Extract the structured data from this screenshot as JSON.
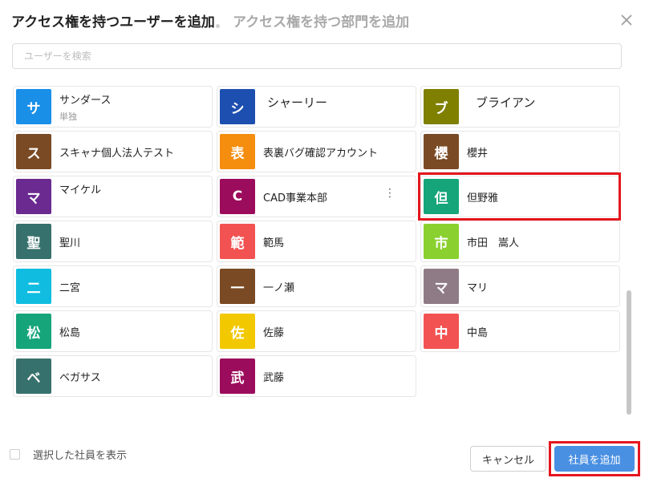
{
  "dialog": {
    "tab_users": "アクセス権を持つユーザーを追加",
    "tab_departments": "アクセス権を持つ部門を追加"
  },
  "search": {
    "placeholder": "ユーザーを検索"
  },
  "users": [
    {
      "initial": "サ",
      "name": "サンダース",
      "sub": "単独",
      "color": "#1a8fe8"
    },
    {
      "initial": "シ",
      "name": "シャーリー",
      "color": "#1d4fb0"
    },
    {
      "initial": "ブ",
      "name": "ブライアン",
      "color": "#7f7f00"
    },
    {
      "initial": "ス",
      "name": "スキャナ個人法人テスト",
      "color": "#7a4a24"
    },
    {
      "initial": "表",
      "name": "表裏バグ確認アカウント",
      "color": "#f58d0f"
    },
    {
      "initial": "櫻",
      "name": "櫻井",
      "color": "#7a4a24"
    },
    {
      "initial": "マ",
      "name": "マイケル",
      "color": "#6a2a90"
    },
    {
      "initial": "C",
      "name": "CAD事業本部",
      "color": "#9c0c5c"
    },
    {
      "initial": "但",
      "name": "但野雅",
      "color": "#16a57a"
    },
    {
      "initial": "聖",
      "name": "聖川",
      "color": "#37716d"
    },
    {
      "initial": "範",
      "name": "範馬",
      "color": "#f25252"
    },
    {
      "initial": "市",
      "name": "市田　嵩人",
      "color": "#8ad12f"
    },
    {
      "initial": "二",
      "name": "二宮",
      "color": "#10bde0"
    },
    {
      "initial": "一",
      "name": "一ノ瀬",
      "color": "#7a4a24"
    },
    {
      "initial": "マ",
      "name": "マリ",
      "color": "#8f7b86"
    },
    {
      "initial": "松",
      "name": "松島",
      "color": "#16a57a"
    },
    {
      "initial": "佐",
      "name": "佐藤",
      "color": "#f2c800"
    },
    {
      "initial": "中",
      "name": "中島",
      "color": "#f25252"
    },
    {
      "initial": "ベ",
      "name": "ベガサス",
      "color": "#37716d"
    },
    {
      "initial": "武",
      "name": "武藤",
      "color": "#9c0c5c"
    }
  ],
  "footer": {
    "show_selected_label": "選択した社員を表示",
    "cancel_label": "キャンセル",
    "add_label": "社員を追加"
  }
}
